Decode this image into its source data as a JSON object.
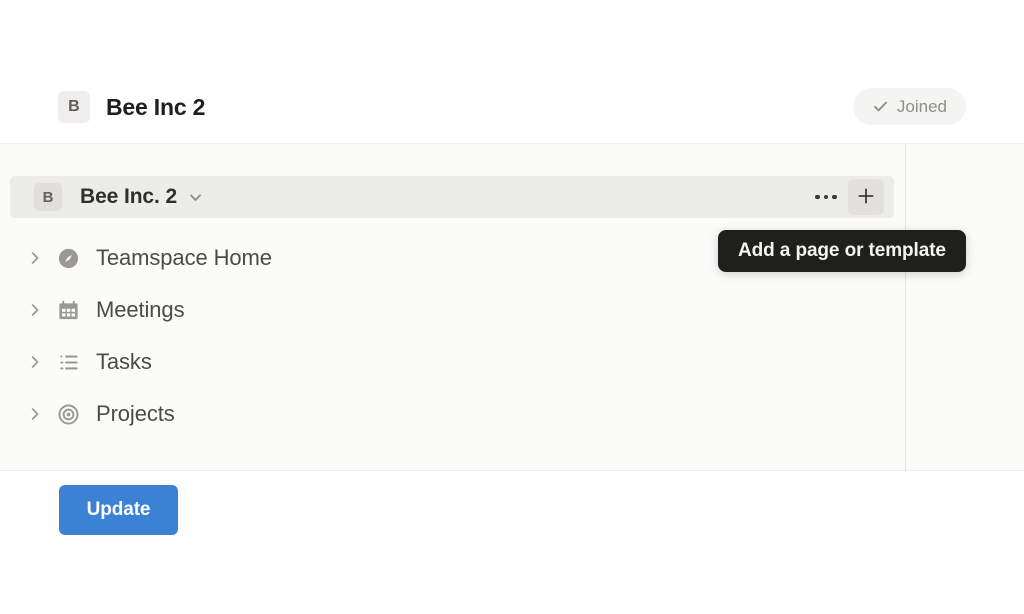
{
  "header": {
    "avatar_letter": "B",
    "title": "Bee Inc 2",
    "status_badge": {
      "label": "Joined",
      "icon": "check-icon"
    }
  },
  "sidebar": {
    "workspace": {
      "avatar_letter": "B",
      "name": "Bee Inc. 2",
      "chevron_icon": "chevron-down-icon",
      "actions": [
        {
          "name": "more-options-button",
          "icon": "ellipsis-icon"
        },
        {
          "name": "add-page-button",
          "icon": "plus-icon",
          "hovered": true
        }
      ]
    },
    "items": [
      {
        "label": "Teamspace Home",
        "icon": "compass-icon",
        "expand_icon": "chevron-right-icon"
      },
      {
        "label": "Meetings",
        "icon": "calendar-icon",
        "expand_icon": "chevron-right-icon"
      },
      {
        "label": "Tasks",
        "icon": "bulleted-list-icon",
        "expand_icon": "chevron-right-icon"
      },
      {
        "label": "Projects",
        "icon": "target-icon",
        "expand_icon": "chevron-right-icon"
      }
    ]
  },
  "tooltip": {
    "text": "Add a page or template"
  },
  "footer": {
    "update_label": "Update"
  },
  "colors": {
    "page_background": "#ffffff",
    "panel_background": "#fbfbfa",
    "selected_row": "#ececeb",
    "tooltip_background": "#1f1f1e",
    "primary_button": "#3b82d4",
    "badge_background": "#f4f4f3",
    "text_primary": "#1f1f1e",
    "text_muted": "#8f8e8a"
  }
}
